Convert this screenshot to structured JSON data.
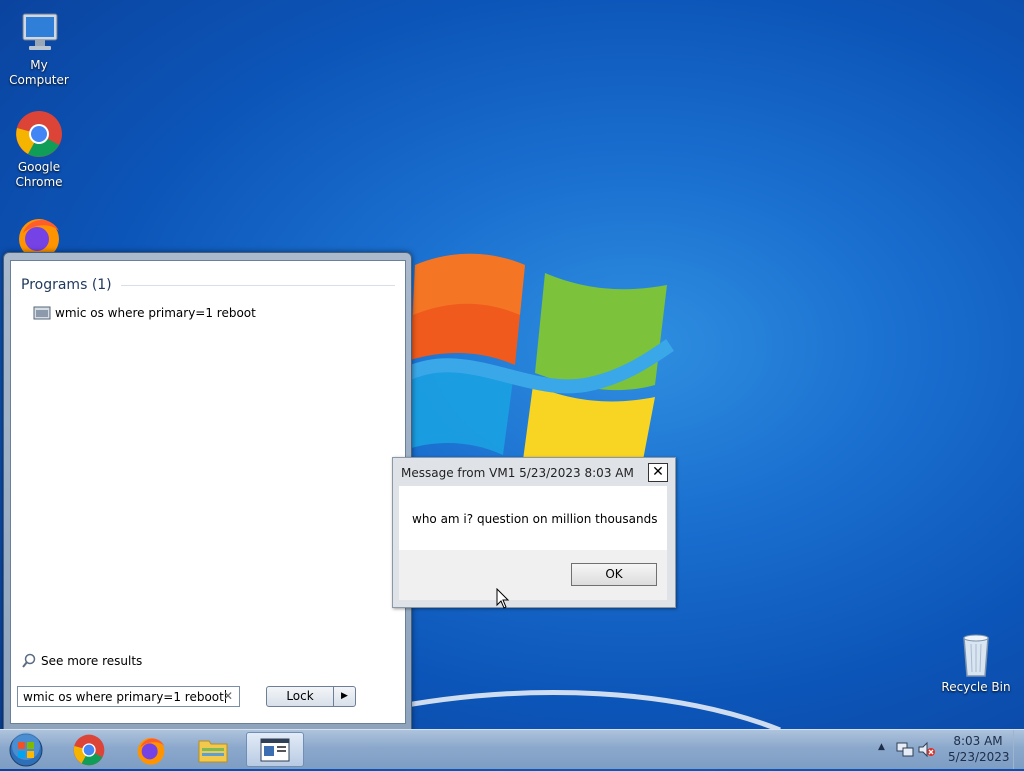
{
  "desktop": {
    "icons": [
      {
        "label": "My Computer"
      },
      {
        "label": "Google Chrome"
      },
      {
        "label": "Firefox"
      },
      {
        "label": "Recycle Bin"
      }
    ]
  },
  "start_menu": {
    "programs_header": "Programs (1)",
    "program_item": "wmic os where primary=1 reboot",
    "see_more": "See more results",
    "search_value": "wmic os where primary=1 reboot",
    "lock_label": "Lock"
  },
  "dialog": {
    "title": "Message from VM1 5/23/2023 8:03 AM",
    "message": "who am i? question on million thousands",
    "ok_label": "OK"
  },
  "taskbar": {
    "clock_time": "8:03 AM",
    "clock_date": "5/23/2023"
  },
  "colors": {
    "desktop_blue": "#1a6fcf",
    "taskbar": "#8ba8cc"
  }
}
